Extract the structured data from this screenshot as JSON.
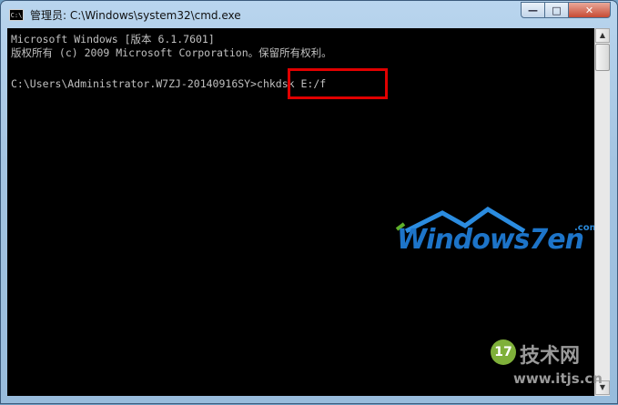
{
  "window": {
    "title": "管理员: C:\\Windows\\system32\\cmd.exe",
    "icon": "cmd-icon",
    "icon_text": "C:\\",
    "controls": {
      "minimize": "—",
      "maximize": "□",
      "close": "✕"
    }
  },
  "console": {
    "lines": [
      "Microsoft Windows [版本 6.1.7601]",
      "版权所有 (c) 2009 Microsoft Corporation。保留所有权利。",
      "",
      "C:\\Users\\Administrator.W7ZJ-20140916SY>chkdsk E:/f"
    ],
    "highlighted_command": "chkdsk E:/f",
    "highlight_color": "#e00000",
    "text_color": "#c0c0c0",
    "background": "#000000"
  },
  "scrollbar": {
    "up": "▲",
    "down": "▼"
  },
  "watermarks": {
    "windows7en": {
      "text": "Windows7en",
      "suffix": ".com"
    },
    "itjs": {
      "badge": "17",
      "cn": "技术网",
      "url": "www.itjs.cn"
    }
  }
}
